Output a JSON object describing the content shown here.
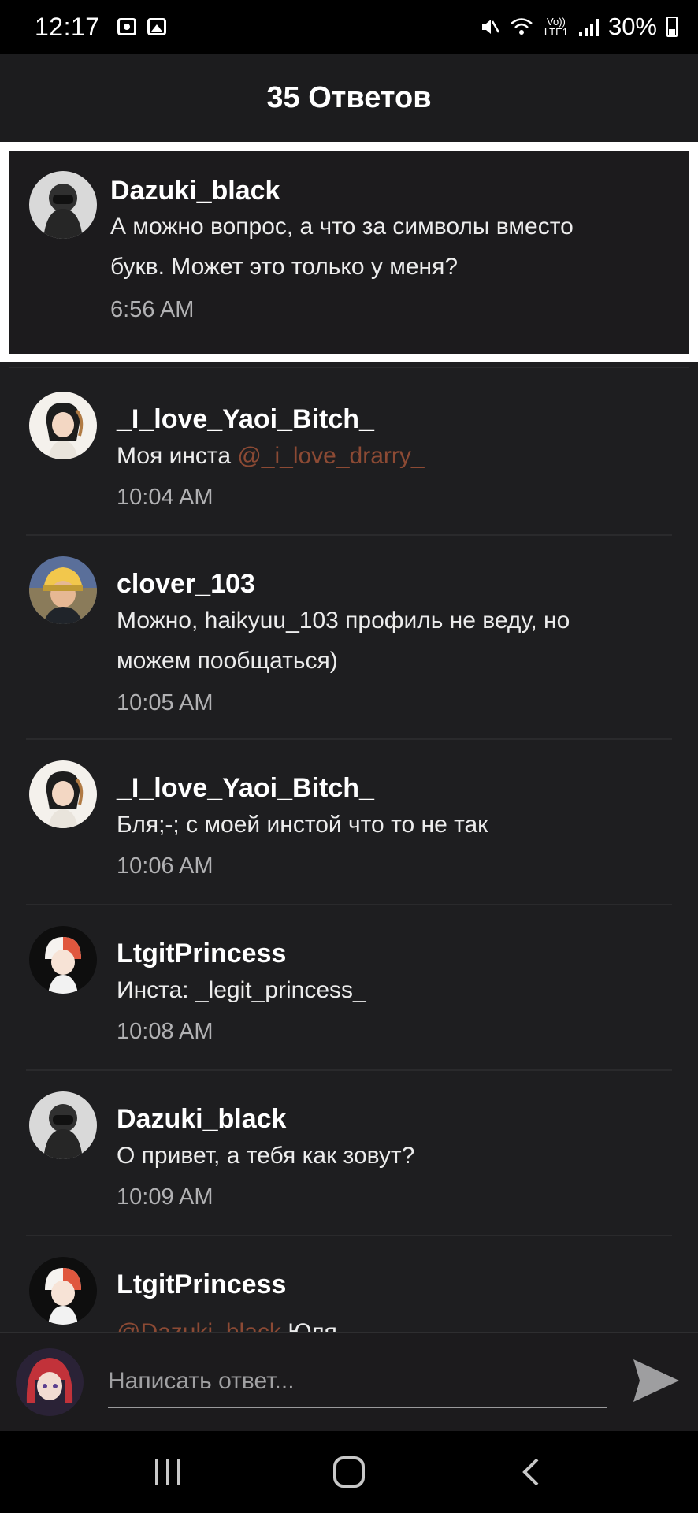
{
  "status_bar": {
    "time": "12:17",
    "battery": "30%",
    "network": "Vo)) LTE1"
  },
  "header": {
    "title": "35 Ответов"
  },
  "parent_comment": {
    "author": "Dazuki_black",
    "text_line1": "А можно вопрос, а что за символы вместо",
    "text_line2": "букв. Может это только у меня?",
    "time": "6:56 AM"
  },
  "replies": [
    {
      "author": "_I_love_Yaoi_Bitch_",
      "text": "Моя инста ",
      "mention": "@_i_love_drarry_",
      "time": "10:04 AM"
    },
    {
      "author": "clover_103",
      "text_line1": "Можно, haikyuu_103 профиль не веду, но",
      "text_line2": "можем пообщаться)",
      "time": "10:05 AM"
    },
    {
      "author": "_I_love_Yaoi_Bitch_",
      "text": "Бля;-; с моей инстой что то не так",
      "time": "10:06 AM"
    },
    {
      "author": "LtgitPrincess",
      "text": "Инста: _legit_princess_",
      "time": "10:08 AM"
    },
    {
      "author": "Dazuki_black",
      "text": "О привет, а тебя как зовут?",
      "time": "10:09 AM"
    },
    {
      "author": "LtgitPrincess",
      "mention": "@Dazuki_black",
      "text": " Юля"
    }
  ],
  "reply_input": {
    "placeholder": "Написать ответ..."
  },
  "colors": {
    "mention": "#8c4a34",
    "background": "#1e1e20",
    "highlight_border": "#ffffff"
  }
}
